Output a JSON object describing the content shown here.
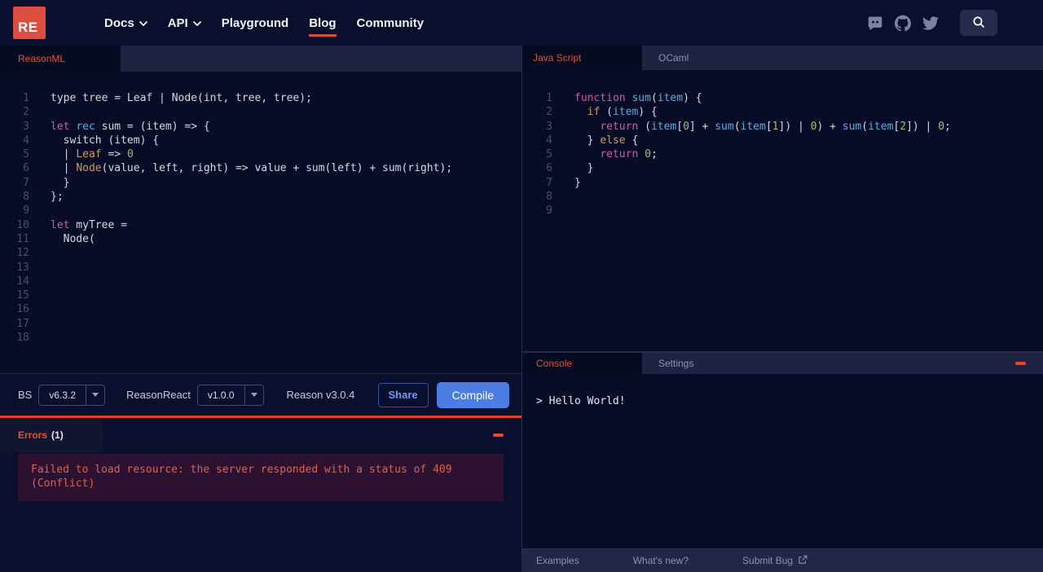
{
  "colors": {
    "accent_red": "#db4d3f",
    "error_red": "#e0604b",
    "compile_blue": "#4b7de2",
    "share_blue": "#6d9bf0",
    "tabbar_bg": "#1e2342",
    "editor_bg": "#080c26"
  },
  "nav": {
    "logo_text": "RE",
    "items": [
      {
        "label": "Docs",
        "has_caret": true,
        "active": false
      },
      {
        "label": "API",
        "has_caret": true,
        "active": false
      },
      {
        "label": "Playground",
        "has_caret": false,
        "active": false
      },
      {
        "label": "Blog",
        "has_caret": false,
        "active": true
      },
      {
        "label": "Community",
        "has_caret": false,
        "active": false
      }
    ],
    "icons": [
      "discord-icon",
      "github-icon",
      "twitter-icon",
      "search-icon"
    ]
  },
  "left_panel": {
    "tab_label": "ReasonML",
    "code_lines": [
      {
        "n": "1",
        "s": [
          [
            "p",
            "type tree = Leaf | Node(int, tree, tree);"
          ]
        ]
      },
      {
        "n": "2",
        "s": []
      },
      {
        "n": "3",
        "s": [
          [
            "k",
            "let"
          ],
          [
            "p",
            " "
          ],
          [
            "b",
            "rec"
          ],
          [
            "p",
            " sum = (item) => {"
          ]
        ]
      },
      {
        "n": "4",
        "s": [
          [
            "p",
            "  switch (item) {"
          ]
        ]
      },
      {
        "n": "5",
        "s": [
          [
            "p",
            "  | "
          ],
          [
            "o",
            "Leaf"
          ],
          [
            "p",
            " => "
          ],
          [
            "g",
            "0"
          ]
        ]
      },
      {
        "n": "6",
        "s": [
          [
            "p",
            "  | "
          ],
          [
            "o",
            "Node"
          ],
          [
            "p",
            "(value, left, right) => value + sum(left) + sum(right);"
          ]
        ]
      },
      {
        "n": "7",
        "s": [
          [
            "p",
            "  }"
          ]
        ]
      },
      {
        "n": "8",
        "s": [
          [
            "p",
            "};"
          ]
        ]
      },
      {
        "n": "9",
        "s": []
      },
      {
        "n": "10",
        "s": [
          [
            "k",
            "let"
          ],
          [
            "p",
            " myTree ="
          ]
        ]
      },
      {
        "n": "11",
        "s": [
          [
            "p",
            "  Node("
          ]
        ]
      },
      {
        "n": "12",
        "s": []
      },
      {
        "n": "13",
        "s": []
      },
      {
        "n": "14",
        "s": []
      },
      {
        "n": "15",
        "s": []
      },
      {
        "n": "16",
        "s": []
      },
      {
        "n": "17",
        "s": []
      },
      {
        "n": "18",
        "s": []
      }
    ]
  },
  "right_panel": {
    "tabs": [
      {
        "label": "Java Script",
        "active": true
      },
      {
        "label": "OCaml",
        "active": false
      }
    ],
    "code_lines": [
      {
        "n": "1",
        "s": [
          [
            "k",
            "function"
          ],
          [
            "p",
            " "
          ],
          [
            "b",
            "sum"
          ],
          [
            "p",
            "("
          ],
          [
            "b",
            "item"
          ],
          [
            "p",
            ") {"
          ]
        ]
      },
      {
        "n": "2",
        "s": [
          [
            "p",
            "  "
          ],
          [
            "o",
            "if"
          ],
          [
            "p",
            " ("
          ],
          [
            "b",
            "item"
          ],
          [
            "p",
            ") {"
          ]
        ]
      },
      {
        "n": "3",
        "s": [
          [
            "p",
            "    "
          ],
          [
            "k",
            "return"
          ],
          [
            "p",
            " ("
          ],
          [
            "b",
            "item"
          ],
          [
            "p",
            "["
          ],
          [
            "g",
            "0"
          ],
          [
            "p",
            "] + "
          ],
          [
            "b",
            "sum"
          ],
          [
            "p",
            "("
          ],
          [
            "b",
            "item"
          ],
          [
            "p",
            "["
          ],
          [
            "g",
            "1"
          ],
          [
            "p",
            "]) | "
          ],
          [
            "g",
            "0"
          ],
          [
            "p",
            ") + "
          ],
          [
            "b",
            "sum"
          ],
          [
            "p",
            "("
          ],
          [
            "b",
            "item"
          ],
          [
            "p",
            "["
          ],
          [
            "g",
            "2"
          ],
          [
            "p",
            "]) | "
          ],
          [
            "g",
            "0"
          ],
          [
            "p",
            ";"
          ]
        ]
      },
      {
        "n": "4",
        "s": [
          [
            "p",
            "  } "
          ],
          [
            "o",
            "else"
          ],
          [
            "p",
            " {"
          ]
        ]
      },
      {
        "n": "5",
        "s": [
          [
            "p",
            "    "
          ],
          [
            "k",
            "return"
          ],
          [
            "p",
            " "
          ],
          [
            "g",
            "0"
          ],
          [
            "p",
            ";"
          ]
        ]
      },
      {
        "n": "6",
        "s": [
          [
            "p",
            "  }"
          ]
        ]
      },
      {
        "n": "7",
        "s": [
          [
            "p",
            "}"
          ]
        ]
      },
      {
        "n": "8",
        "s": []
      },
      {
        "n": "9",
        "s": []
      }
    ]
  },
  "toolbar": {
    "bs_label": "BS",
    "bs_version": "v6.3.2",
    "reasonreact_label": "ReasonReact",
    "reasonreact_version": "v1.0.0",
    "reason_version": "Reason v3.0.4",
    "share_label": "Share",
    "compile_label": "Compile"
  },
  "errors": {
    "title": "Errors",
    "count": "(1)",
    "message": "Failed to load resource: the server responded with a status of 409 (Conflict)"
  },
  "console": {
    "tabs": [
      {
        "label": "Console",
        "active": true
      },
      {
        "label": "Settings",
        "active": false
      }
    ],
    "output": "> Hello World!"
  },
  "footer": {
    "items": [
      {
        "label": "Examples"
      },
      {
        "label": "What's new?"
      },
      {
        "label": "Submit Bug",
        "has_external_icon": true
      }
    ]
  }
}
